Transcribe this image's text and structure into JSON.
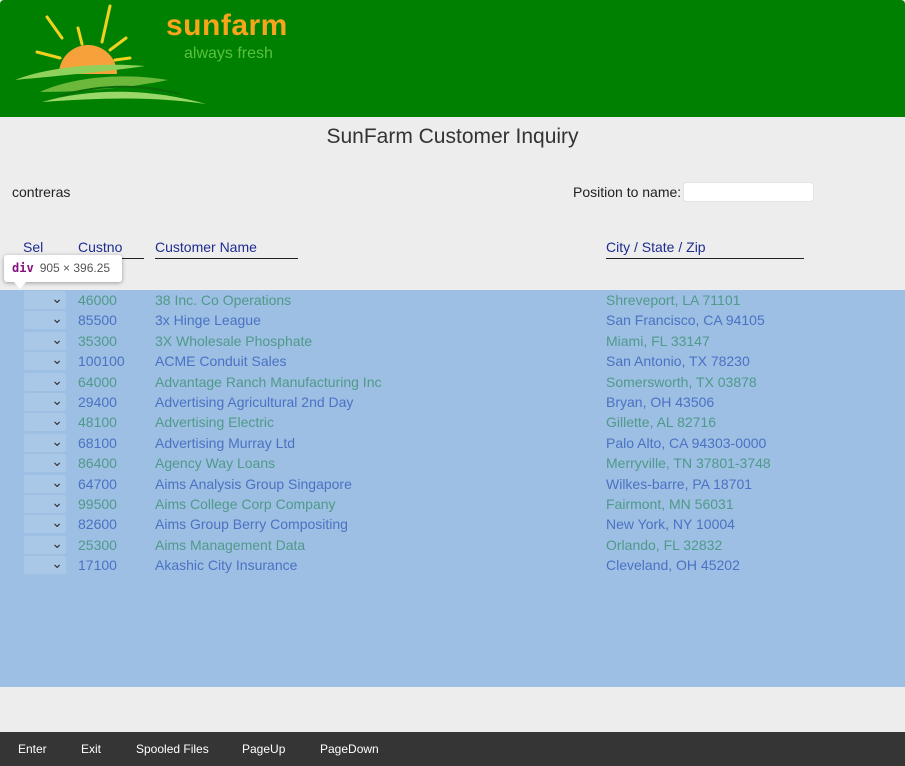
{
  "brand": {
    "name": "sunfarm",
    "tagline": "always fresh"
  },
  "title": "SunFarm Customer Inquiry",
  "user": "contreras",
  "position": {
    "label": "Position to name:",
    "value": ""
  },
  "columns": {
    "sel": "Sel",
    "custno": "Custno",
    "name": "Customer Name",
    "city": "City / State / Zip"
  },
  "devtools": {
    "tag": "div",
    "dims": "905 × 396.25"
  },
  "rows": [
    {
      "custno": "46000",
      "name": "38 Inc. Co Operations",
      "city": "Shreveport, LA 71101"
    },
    {
      "custno": "85500",
      "name": "3x Hinge League",
      "city": "San Francisco, CA 94105"
    },
    {
      "custno": "35300",
      "name": "3X Wholesale Phosphate",
      "city": "Miami, FL 33147"
    },
    {
      "custno": "100100",
      "name": "ACME Conduit Sales",
      "city": "San Antonio, TX 78230"
    },
    {
      "custno": "64000",
      "name": "Advantage Ranch Manufacturing Inc",
      "city": "Somersworth, TX 03878"
    },
    {
      "custno": "29400",
      "name": "Advertising Agricultural 2nd Day",
      "city": "Bryan, OH 43506"
    },
    {
      "custno": "48100",
      "name": "Advertising Electric",
      "city": "Gillette, AL 82716"
    },
    {
      "custno": "68100",
      "name": "Advertising Murray Ltd",
      "city": "Palo Alto, CA 94303-0000"
    },
    {
      "custno": "86400",
      "name": "Agency Way Loans",
      "city": "Merryville, TN 37801-3748"
    },
    {
      "custno": "64700",
      "name": "Aims Analysis Group Singapore",
      "city": "Wilkes-barre, PA 18701"
    },
    {
      "custno": "99500",
      "name": "Aims College Corp Company",
      "city": "Fairmont, MN 56031"
    },
    {
      "custno": "82600",
      "name": "Aims Group Berry Compositing",
      "city": "New York, NY 10004"
    },
    {
      "custno": "25300",
      "name": "Aims Management Data",
      "city": "Orlando, FL 32832"
    },
    {
      "custno": "17100",
      "name": "Akashic City Insurance",
      "city": "Cleveland, OH 45202"
    }
  ],
  "footer": {
    "enter": "Enter",
    "exit": "Exit",
    "spooled": "Spooled Files",
    "pageup": "PageUp",
    "pagedown": "PageDown"
  }
}
